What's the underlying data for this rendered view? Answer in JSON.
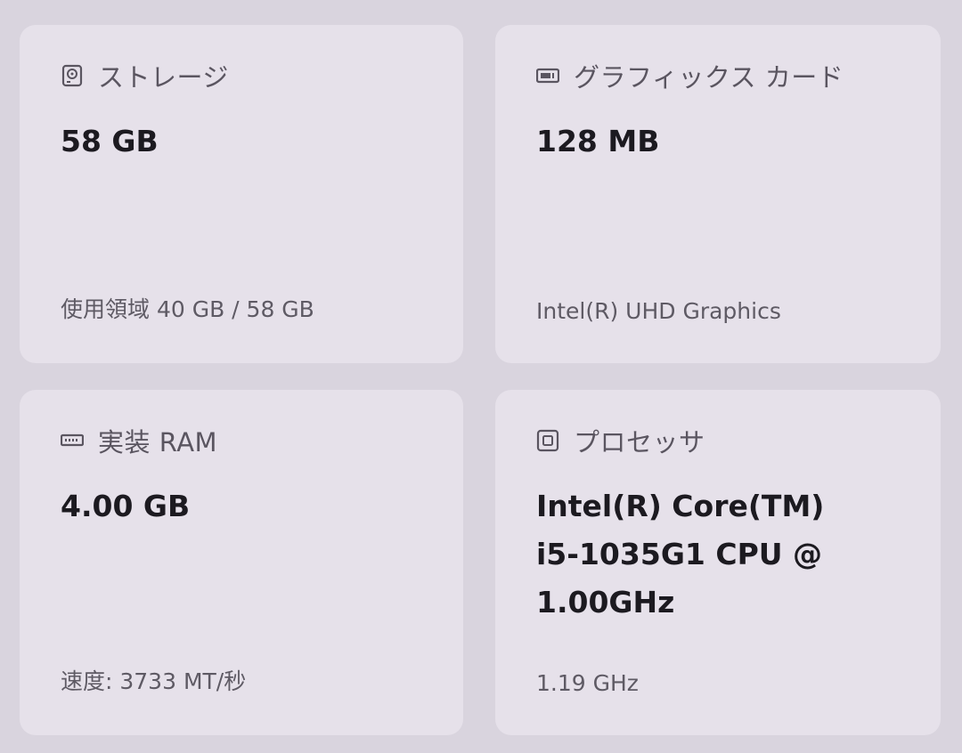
{
  "storage": {
    "icon": "storage-icon",
    "title": "ストレージ",
    "value": "58 GB",
    "detail": "使用領域 40 GB / 58 GB"
  },
  "gpu": {
    "icon": "graphics-card-icon",
    "title": "グラフィックス カード",
    "value": "128 MB",
    "detail": "Intel(R) UHD Graphics"
  },
  "ram": {
    "icon": "memory-icon",
    "title": "実装 RAM",
    "value": "4.00 GB",
    "detail": "速度: 3733 MT/秒"
  },
  "cpu": {
    "icon": "processor-icon",
    "title": "プロセッサ",
    "value_lines": [
      "Intel(R) Core(TM)",
      "i5-1035G1 CPU @",
      "1.00GHz"
    ],
    "detail": "1.19 GHz"
  }
}
